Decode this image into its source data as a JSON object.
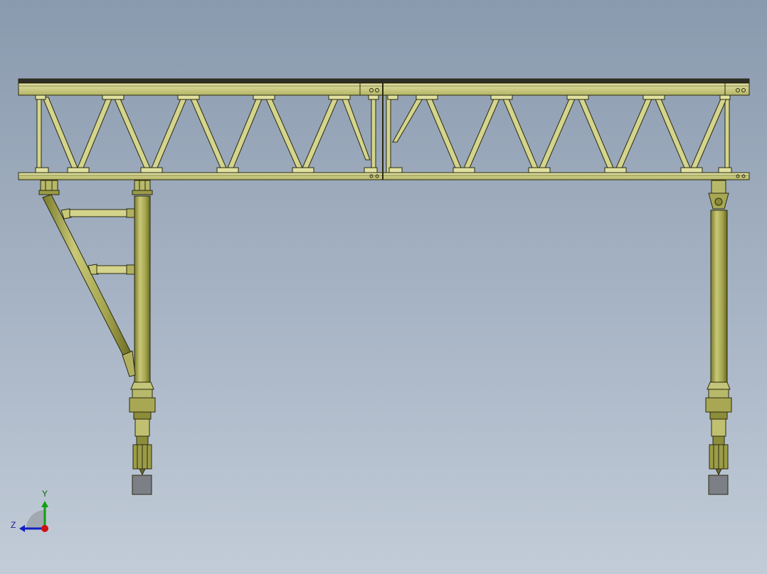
{
  "viewport": {
    "background_top": "#8a9aae",
    "background_bottom": "#c2ccd8"
  },
  "model": {
    "description_colors": {
      "steel_face": "#cfcf86",
      "steel_dark": "#8a8a3a",
      "steel_outline": "#2a2a10",
      "column_shade": "#9c9c40",
      "footing": "#7d7f86"
    },
    "parts": [
      "truss-girder-left",
      "truss-girder-right",
      "column-left",
      "column-right",
      "diagonal-brace",
      "strut-upper",
      "strut-lower",
      "footing-left",
      "footing-right"
    ]
  },
  "triad": {
    "y_label": "Y",
    "z_label": "Z",
    "x_color": "#d01010",
    "y_color": "#10a010",
    "z_color": "#1020c0"
  }
}
